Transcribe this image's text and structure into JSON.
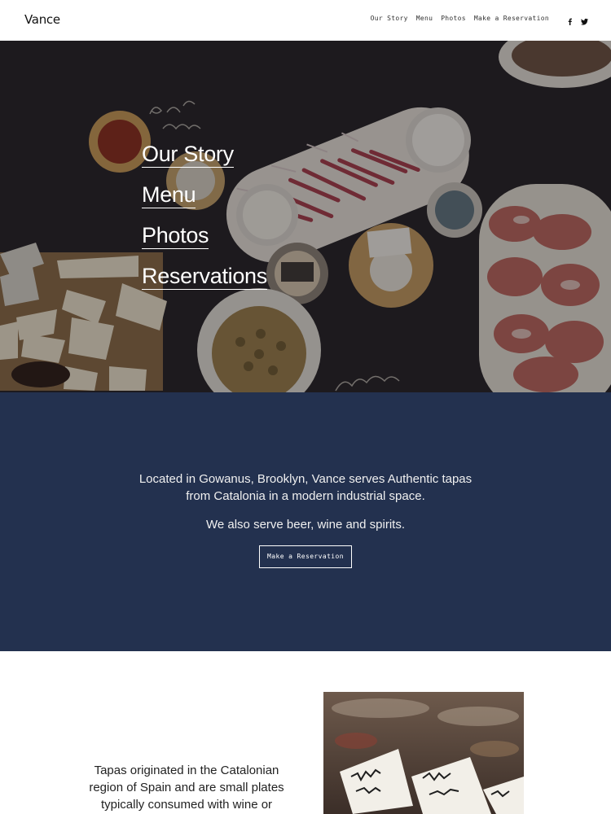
{
  "header": {
    "logo": "Vance",
    "nav": [
      {
        "label": "Our Story"
      },
      {
        "label": "Menu"
      },
      {
        "label": "Photos"
      },
      {
        "label": "Make a Reservation"
      }
    ],
    "social_icons": [
      "facebook-icon",
      "twitter-icon"
    ]
  },
  "hero": {
    "links": [
      {
        "label": "Our Story"
      },
      {
        "label": "Menu"
      },
      {
        "label": "Photos"
      },
      {
        "label": "Reservations"
      }
    ]
  },
  "intro": {
    "paragraph1": "Located in Gowanus, Brooklyn, Vance serves Authentic tapas from Catalonia in a modern industrial space.",
    "paragraph2": "We also serve beer, wine and spirits.",
    "button": "Make a Reservation",
    "background": "#23314f"
  },
  "lower": {
    "text": "Tapas originated in the Catalonian region of Spain and are small plates typically consumed with wine or vermouth."
  }
}
